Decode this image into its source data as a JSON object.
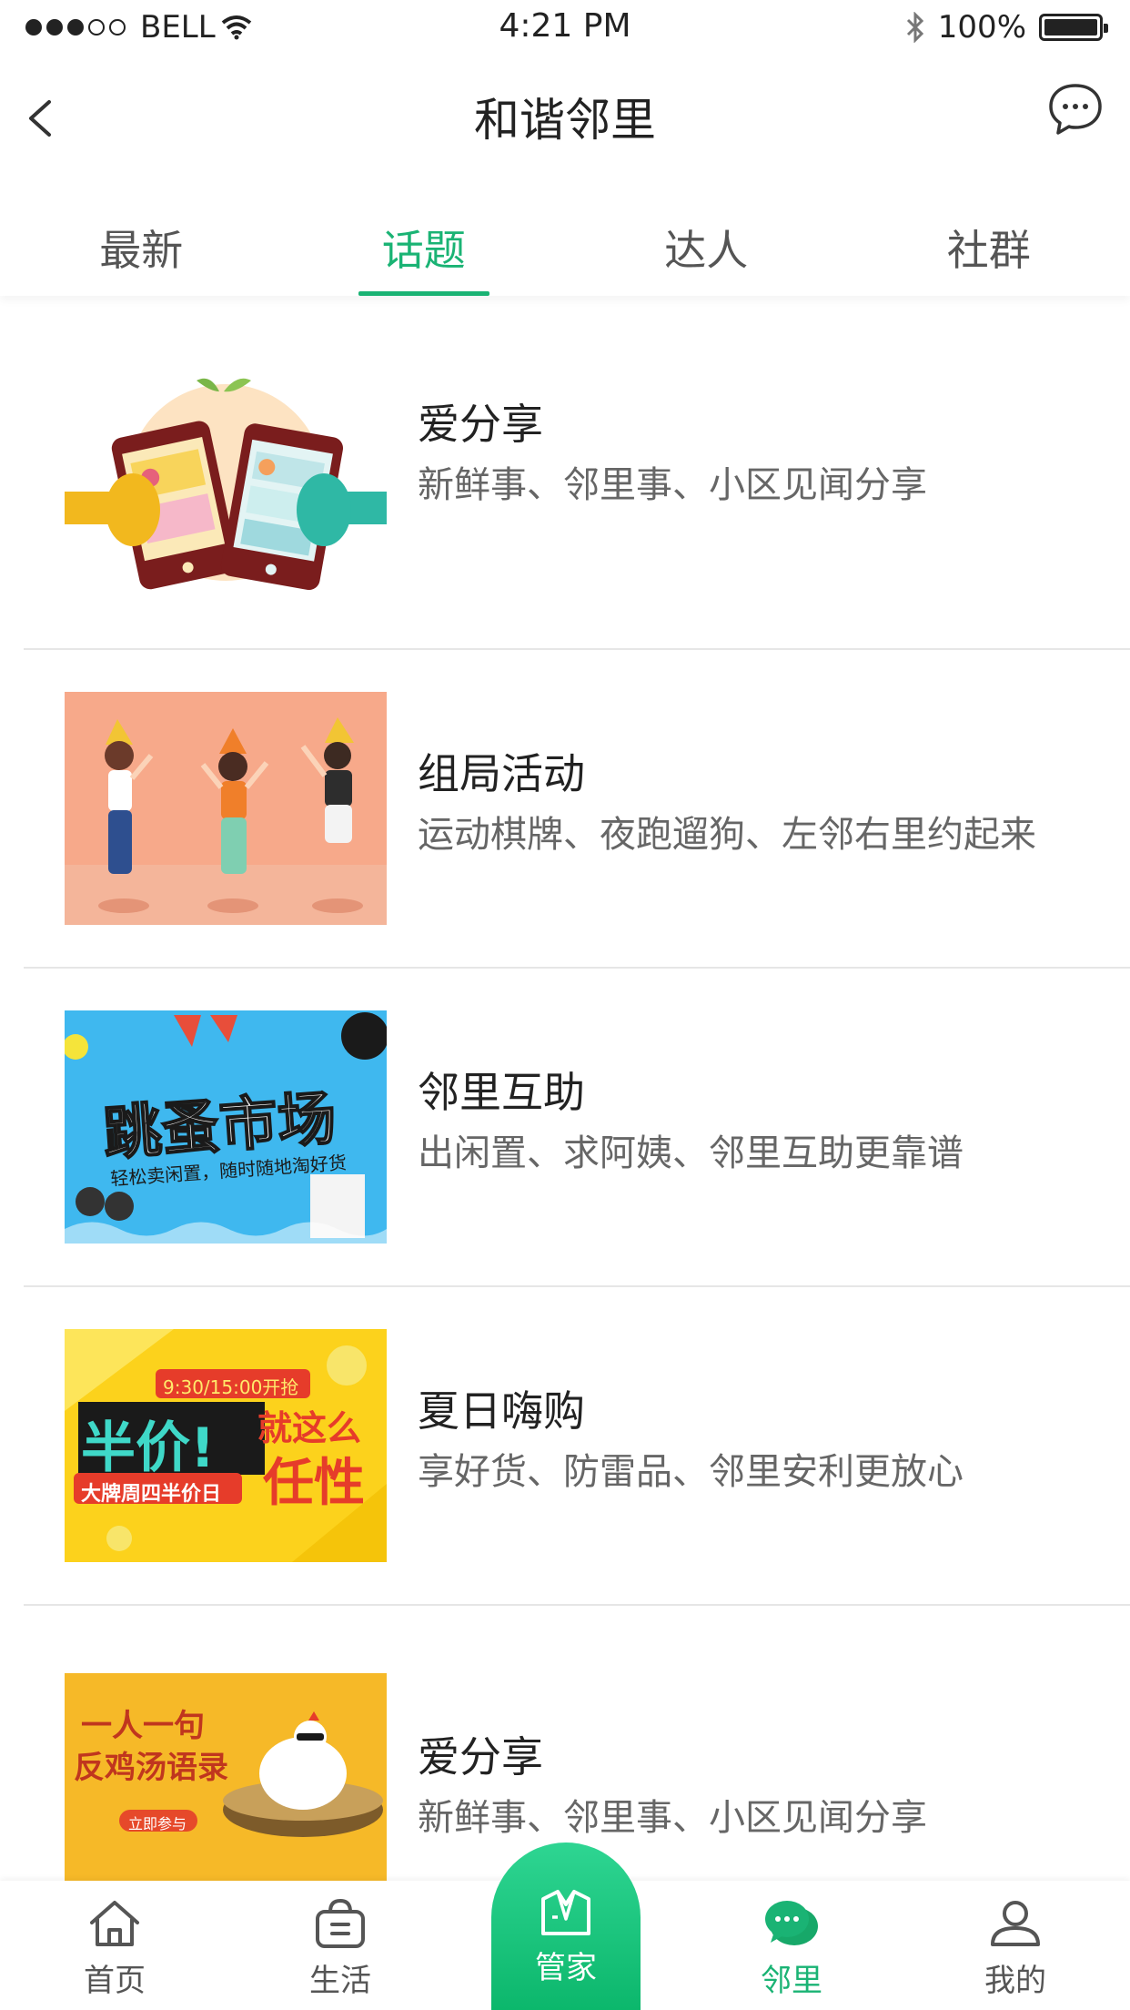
{
  "status_bar": {
    "carrier": "BELL",
    "time": "4:21 PM",
    "battery": "100%"
  },
  "nav": {
    "title": "和谐邻里"
  },
  "tabs": [
    {
      "label": "最新",
      "active": false
    },
    {
      "label": "话题",
      "active": true
    },
    {
      "label": "达人",
      "active": false
    },
    {
      "label": "社群",
      "active": false
    }
  ],
  "topics": [
    {
      "title": "爱分享",
      "desc": "新鲜事、邻里事、小区见闻分享"
    },
    {
      "title": "组局活动",
      "desc": "运动棋牌、夜跑遛狗、左邻右里约起来"
    },
    {
      "title": "邻里互助",
      "desc": "出闲置、求阿姨、邻里互助更靠谱",
      "banner_text": [
        "跳蚤市场",
        "轻松卖闲置，随时随地淘好货"
      ]
    },
    {
      "title": "夏日嗨购",
      "desc": "享好货、防雷品、邻里安利更放心",
      "banner_text": [
        "9:30/15:00开抢",
        "半价!",
        "就这么",
        "任性",
        "大牌周四半价日"
      ]
    },
    {
      "title": "爱分享",
      "desc": "新鲜事、邻里事、小区见闻分享",
      "banner_text": [
        "一人一句",
        "反鸡汤语录",
        "立即参与"
      ]
    }
  ],
  "tabbar": {
    "home": "首页",
    "life": "生活",
    "butler": "管家",
    "neighbor": "邻里",
    "mine": "我的"
  },
  "colors": {
    "accent": "#1ab374",
    "text": "#222222",
    "subtext": "#666666"
  }
}
